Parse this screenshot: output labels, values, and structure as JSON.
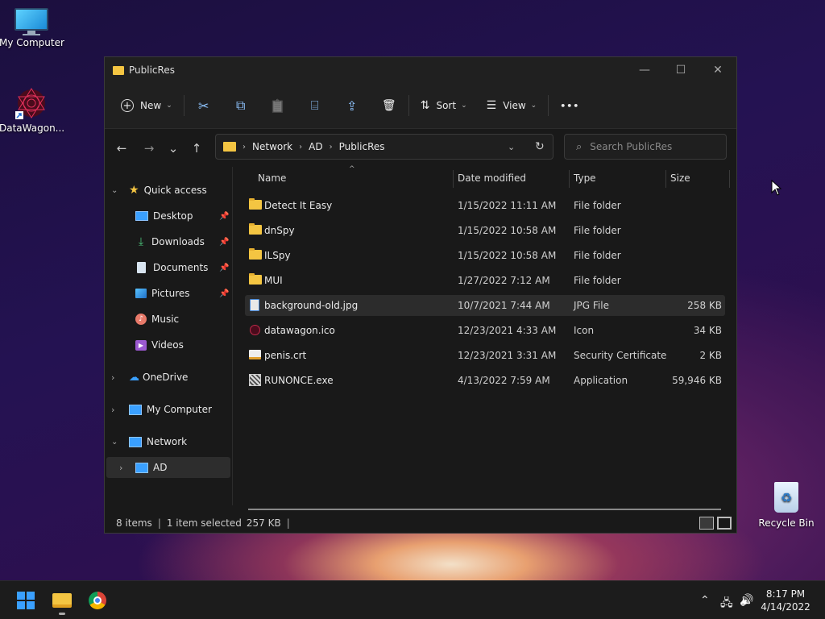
{
  "desktop": {
    "icons": [
      {
        "label": "My Computer",
        "icon": "computer-icon"
      },
      {
        "label": "DataWagon...",
        "icon": "datawagon-shortcut-icon"
      }
    ],
    "recycle_bin": {
      "label": "Recycle Bin",
      "icon": "recycle-bin-icon"
    }
  },
  "window": {
    "title": "PublicRes",
    "controls": {
      "minimize": "—",
      "maximize": "☐",
      "close": "✕"
    }
  },
  "toolbar": {
    "new_label": "New",
    "sort_label": "Sort",
    "view_label": "View",
    "more_label": "•••",
    "icons": {
      "cut": "✂",
      "copy": "⧉",
      "paste": "📋",
      "rename": "⌸",
      "share": "⇪",
      "delete": "🗑"
    }
  },
  "nav": {
    "back": "←",
    "forward": "→",
    "recent": "⌄",
    "up": "↑",
    "breadcrumbs": [
      "Network",
      "AD",
      "PublicRes"
    ],
    "search_placeholder": "Search PublicRes"
  },
  "sidebar": {
    "quick_access": "Quick access",
    "items": [
      {
        "label": "Desktop",
        "pinned": true
      },
      {
        "label": "Downloads",
        "pinned": true
      },
      {
        "label": "Documents",
        "pinned": true
      },
      {
        "label": "Pictures",
        "pinned": true
      },
      {
        "label": "Music",
        "pinned": false
      },
      {
        "label": "Videos",
        "pinned": false
      }
    ],
    "onedrive": "OneDrive",
    "my_computer": "My Computer",
    "network": "Network",
    "ad": "AD"
  },
  "columns": {
    "name": "Name",
    "date": "Date modified",
    "type": "Type",
    "size": "Size"
  },
  "files": [
    {
      "name": "Detect It Easy",
      "date": "1/15/2022 11:11 AM",
      "type": "File folder",
      "size": "",
      "kind": "folder"
    },
    {
      "name": "dnSpy",
      "date": "1/15/2022 10:58 AM",
      "type": "File folder",
      "size": "",
      "kind": "folder"
    },
    {
      "name": "ILSpy",
      "date": "1/15/2022 10:58 AM",
      "type": "File folder",
      "size": "",
      "kind": "folder"
    },
    {
      "name": "MUI",
      "date": "1/27/2022 7:12 AM",
      "type": "File folder",
      "size": "",
      "kind": "folder"
    },
    {
      "name": "background-old.jpg",
      "date": "10/7/2021 7:44 AM",
      "type": "JPG File",
      "size": "258 KB",
      "kind": "image",
      "selected": true
    },
    {
      "name": "datawagon.ico",
      "date": "12/23/2021 4:33 AM",
      "type": "Icon",
      "size": "34 KB",
      "kind": "icon"
    },
    {
      "name": "penis.crt",
      "date": "12/23/2021 3:31 AM",
      "type": "Security Certificate",
      "size": "2 KB",
      "kind": "cert"
    },
    {
      "name": "RUNONCE.exe",
      "date": "4/13/2022 7:59 AM",
      "type": "Application",
      "size": "59,946 KB",
      "kind": "exe"
    }
  ],
  "status": {
    "items": "8 items",
    "selected": "1 item selected",
    "selected_size": "257 KB"
  },
  "taskbar": {
    "time": "8:17 PM",
    "date": "4/14/2022",
    "tray": {
      "chevron": "⌃",
      "network": "🖧",
      "volume": "🔊"
    }
  },
  "colors": {
    "accent": "#3aa0ff",
    "folder": "#f4c542",
    "window_bg": "#191919"
  }
}
